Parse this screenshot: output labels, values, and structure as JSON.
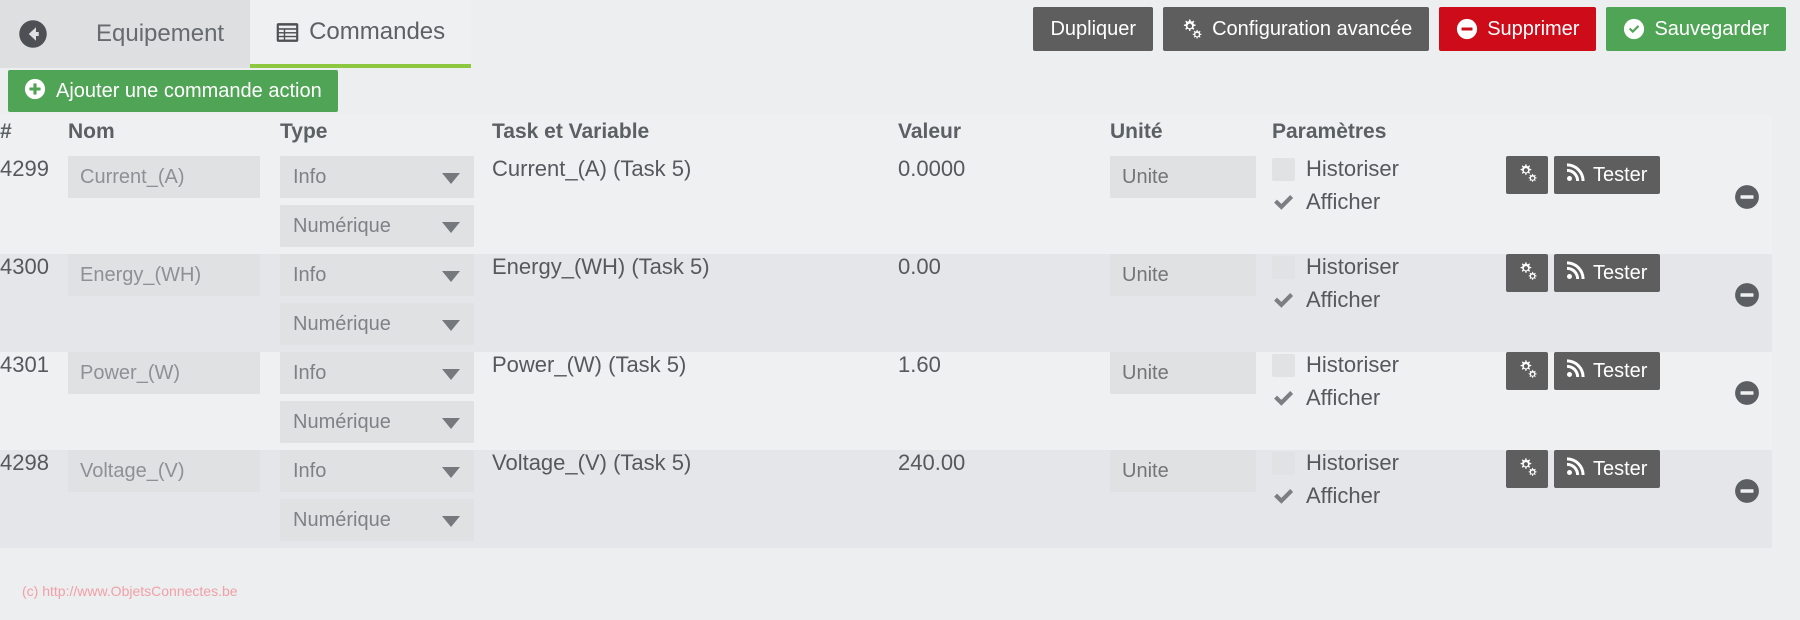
{
  "header": {
    "back_icon": "arrow-circle-left-icon",
    "tabs": [
      {
        "label": "Equipement",
        "icon": null,
        "active": false
      },
      {
        "label": "Commandes",
        "icon": "table-list-icon",
        "active": true
      }
    ],
    "buttons": [
      {
        "label": "Dupliquer",
        "icon": null,
        "style": "grey"
      },
      {
        "label": "Configuration avancée",
        "icon": "cogs-icon",
        "style": "grey"
      },
      {
        "label": "Supprimer",
        "icon": "minus-circle-icon",
        "style": "red"
      },
      {
        "label": "Sauvegarder",
        "icon": "check-circle-icon",
        "style": "green"
      }
    ]
  },
  "toolbar": {
    "add_label": "Ajouter une commande action",
    "add_icon": "plus-circle-icon"
  },
  "table": {
    "headers": {
      "id": "#",
      "nom": "Nom",
      "type": "Type",
      "task": "Task et Variable",
      "valeur": "Valeur",
      "unite": "Unité",
      "parametres": "Paramètres"
    },
    "unite_placeholder": "Unite",
    "param_labels": {
      "historiser": "Historiser",
      "afficher": "Afficher"
    },
    "action_labels": {
      "config": "",
      "test": "Tester"
    },
    "action_icons": {
      "config": "cogs-icon",
      "test": "rss-icon",
      "remove": "minus-circle-icon"
    },
    "rows": [
      {
        "id": "4299",
        "nom": "Current_(A)",
        "type": "Info",
        "subtype": "Numérique",
        "task": "Current_(A) (Task 5)",
        "valeur": "0.0000",
        "unite": "",
        "historiser": false,
        "afficher": true
      },
      {
        "id": "4300",
        "nom": "Energy_(WH)",
        "type": "Info",
        "subtype": "Numérique",
        "task": "Energy_(WH) (Task 5)",
        "valeur": "0.00",
        "unite": "",
        "historiser": false,
        "afficher": true
      },
      {
        "id": "4301",
        "nom": "Power_(W)",
        "type": "Info",
        "subtype": "Numérique",
        "task": "Power_(W) (Task 5)",
        "valeur": "1.60",
        "unite": "",
        "historiser": false,
        "afficher": true
      },
      {
        "id": "4298",
        "nom": "Voltage_(V)",
        "type": "Info",
        "subtype": "Numérique",
        "task": "Voltage_(V) (Task 5)",
        "valeur": "240.00",
        "unite": "",
        "historiser": false,
        "afficher": true
      }
    ]
  },
  "watermark": {
    "text": "(c) http://www.ObjetsConnectes.be"
  },
  "colors": {
    "accent_green": "#8dc63f",
    "button_green": "#4fa555",
    "button_red": "#ce0b19",
    "button_grey": "#5e5e5e",
    "page_bg": "#eceef0",
    "row_light": "#eff0f1",
    "row_dark": "#e5e6ea",
    "watermark": "#f0a0a6"
  }
}
